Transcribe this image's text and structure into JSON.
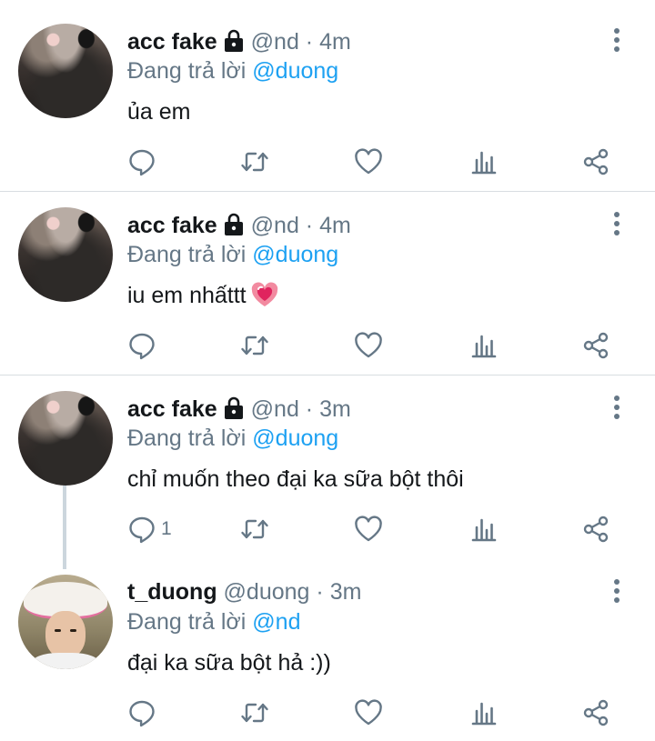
{
  "tweets": [
    {
      "avatar_icon": "cat-avatar-icon",
      "name": "acc fake",
      "locked_icon": "lock-icon",
      "handle": "@nd",
      "dot": "·",
      "time": "4m",
      "replying_prefix": "Đang trả lời",
      "replying_to": "@duong",
      "text": "ủa em",
      "reply_count": ""
    },
    {
      "avatar_icon": "cat-avatar-icon",
      "name": "acc fake",
      "locked_icon": "lock-icon",
      "handle": "@nd",
      "dot": "·",
      "time": "4m",
      "replying_prefix": "Đang trả lời",
      "replying_to": "@duong",
      "text": "iu em nhấttt",
      "emoji": "sparkling-heart-icon",
      "reply_count": ""
    },
    {
      "avatar_icon": "cat-avatar-icon",
      "name": "acc fake",
      "locked_icon": "lock-icon",
      "handle": "@nd",
      "dot": "·",
      "time": "3m",
      "replying_prefix": "Đang trả lời",
      "replying_to": "@duong",
      "text": "chỉ muốn theo đại ka sữa bột thôi",
      "reply_count": "1"
    },
    {
      "avatar_icon": "person-avatar-icon",
      "name": "t_duong",
      "handle": "@duong",
      "dot": "·",
      "time": "3m",
      "replying_prefix": "Đang trả lời",
      "replying_to": "@nd",
      "text": "đại ka sữa bột hả :))",
      "reply_count": ""
    }
  ],
  "colors": {
    "accent": "#1da1f2",
    "secondary_text": "#657786",
    "primary_text": "#14171a",
    "separator": "#d8dde1",
    "thread_line": "#ccd6dd"
  },
  "action_icons": [
    "reply-icon",
    "retweet-icon",
    "like-icon",
    "analytics-icon",
    "share-icon"
  ]
}
